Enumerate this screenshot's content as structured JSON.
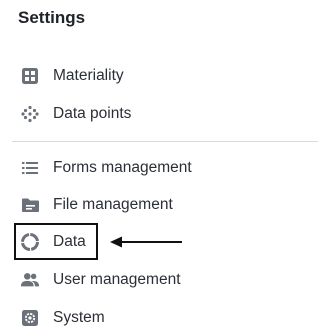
{
  "settings": {
    "title": "Settings",
    "items": [
      {
        "label": "Materiality",
        "icon": "grid-icon"
      },
      {
        "label": "Data points",
        "icon": "dots-grid-icon"
      },
      {
        "label": "Forms management",
        "icon": "list-icon"
      },
      {
        "label": "File management",
        "icon": "folder-icon"
      },
      {
        "label": "Data",
        "icon": "circle-dashed-icon"
      },
      {
        "label": "User management",
        "icon": "people-icon"
      },
      {
        "label": "System",
        "icon": "settings-box-icon"
      }
    ]
  },
  "colors": {
    "icon": "#6b7079",
    "text": "#2b2f36",
    "divider": "#d9dadd",
    "annotation": "#111111"
  }
}
